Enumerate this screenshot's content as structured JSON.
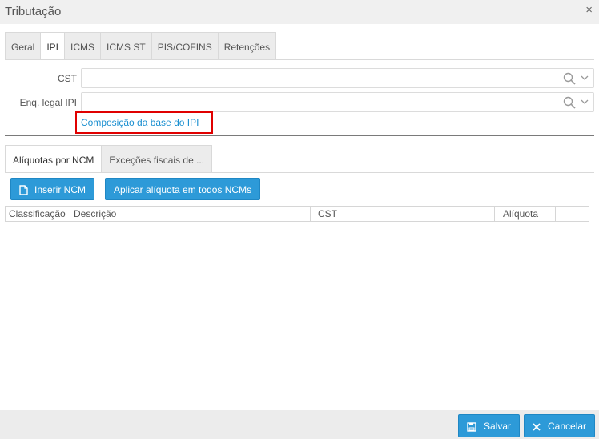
{
  "dialog": {
    "title": "Tributação",
    "close_glyph": "×"
  },
  "main_tabs": [
    {
      "label": "Geral"
    },
    {
      "label": "IPI"
    },
    {
      "label": "ICMS"
    },
    {
      "label": "ICMS ST"
    },
    {
      "label": "PIS/COFINS"
    },
    {
      "label": "Retenções"
    }
  ],
  "active_main_tab": "IPI",
  "form": {
    "cst_label": "CST",
    "cst_value": "",
    "enq_label": "Enq. legal IPI",
    "enq_value": "",
    "composition_link": "Composição da base do IPI"
  },
  "sub_tabs": [
    {
      "label": "Alíquotas por NCM"
    },
    {
      "label": "Exceções fiscais de ..."
    }
  ],
  "active_sub_tab": "Alíquotas por NCM",
  "toolbar": {
    "insert_ncm": "Inserir NCM",
    "apply_all": "Aplicar alíquota em todos NCMs"
  },
  "grid": {
    "columns": [
      "Classificação",
      "Descrição",
      "CST",
      "Alíquota"
    ],
    "rows": []
  },
  "footer": {
    "save": "Salvar",
    "cancel": "Cancelar"
  },
  "colors": {
    "primary": "#2d9ad8",
    "link": "#1a8fd0",
    "highlight": "#e00000"
  }
}
